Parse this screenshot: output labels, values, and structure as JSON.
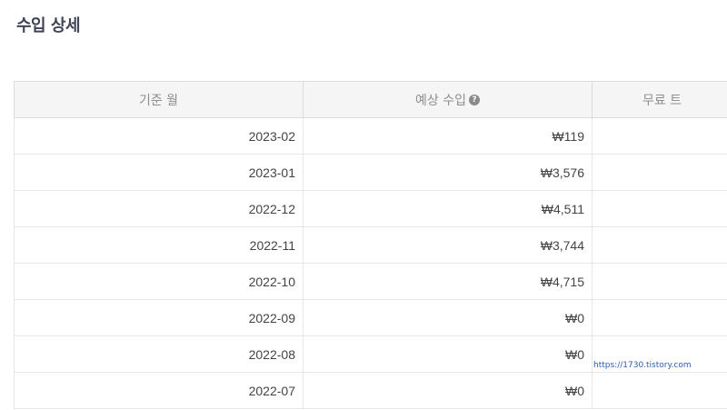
{
  "page": {
    "title": "수입 상세"
  },
  "table": {
    "headers": {
      "month": "기준 월",
      "estimated_revenue": "예상 수입",
      "third": "무료 트"
    },
    "help_icon_glyph": "?",
    "rows": [
      {
        "month": "2023-02",
        "revenue": "₩119"
      },
      {
        "month": "2023-01",
        "revenue": "₩3,576"
      },
      {
        "month": "2022-12",
        "revenue": "₩4,511"
      },
      {
        "month": "2022-11",
        "revenue": "₩3,744"
      },
      {
        "month": "2022-10",
        "revenue": "₩4,715"
      },
      {
        "month": "2022-09",
        "revenue": "₩0"
      },
      {
        "month": "2022-08",
        "revenue": "₩0"
      },
      {
        "month": "2022-07",
        "revenue": "₩0"
      }
    ]
  },
  "watermark": "https://1730.tistory.com",
  "icons": [
    "question-circle-icon"
  ],
  "colors": {
    "title": "#3f4456",
    "header_bg": "#f5f5f5",
    "header_text": "#8e8e8e",
    "cell_text": "#444444",
    "watermark": "#2a5db0"
  }
}
